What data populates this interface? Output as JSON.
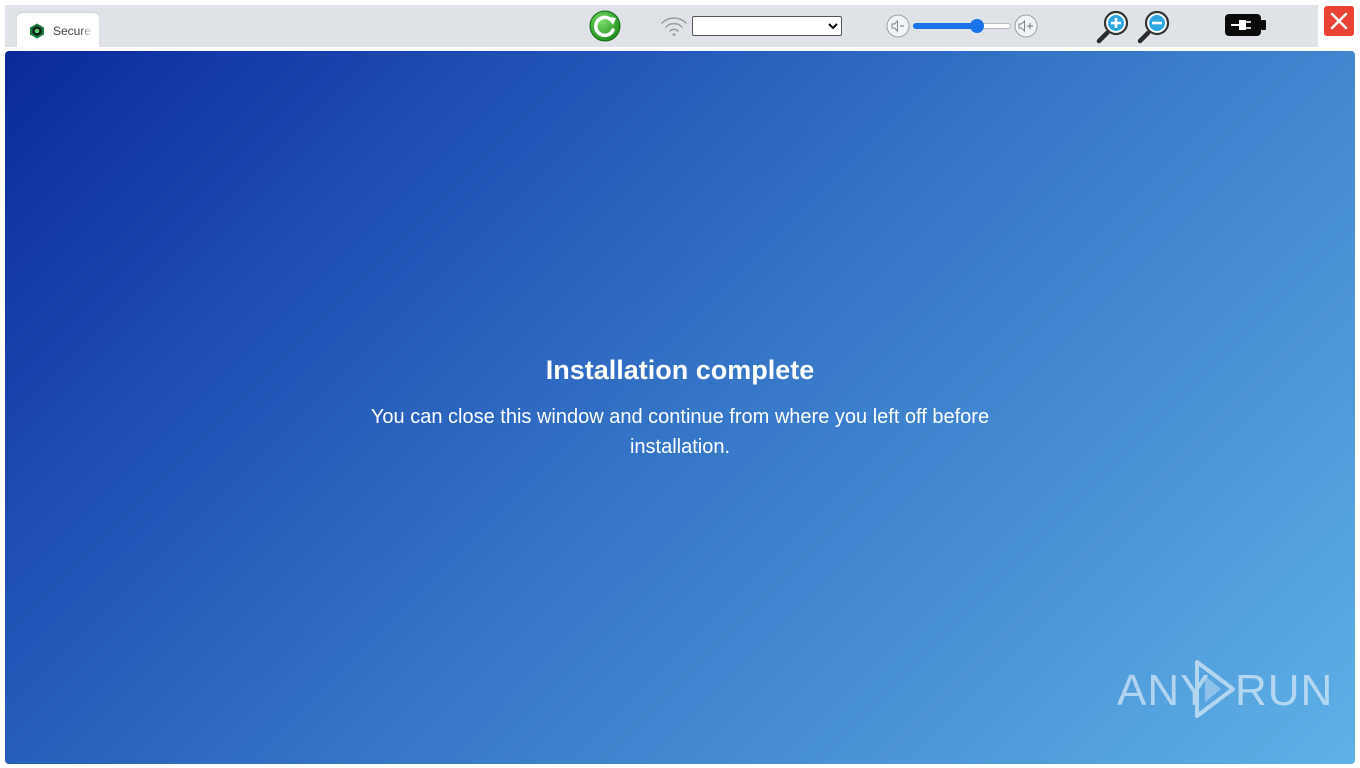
{
  "tab": {
    "title": "Secure"
  },
  "network": {
    "selected": ""
  },
  "volume": {
    "level": 0.65
  },
  "content": {
    "heading": "Installation complete",
    "body": "You can close this window and continue from where you left off before installation."
  },
  "watermark": {
    "left": "ANY",
    "right": "RUN"
  },
  "colors": {
    "accent": "#1a73e8",
    "close": "#e94235",
    "gradient_start": "#0b2a9a",
    "gradient_end": "#5eb1e6"
  },
  "icons": [
    "shield-icon",
    "refresh-icon",
    "wifi-icon",
    "volume-down-icon",
    "volume-up-icon",
    "zoom-in-icon",
    "zoom-out-icon",
    "plug-icon",
    "close-icon",
    "play-logo-icon"
  ]
}
